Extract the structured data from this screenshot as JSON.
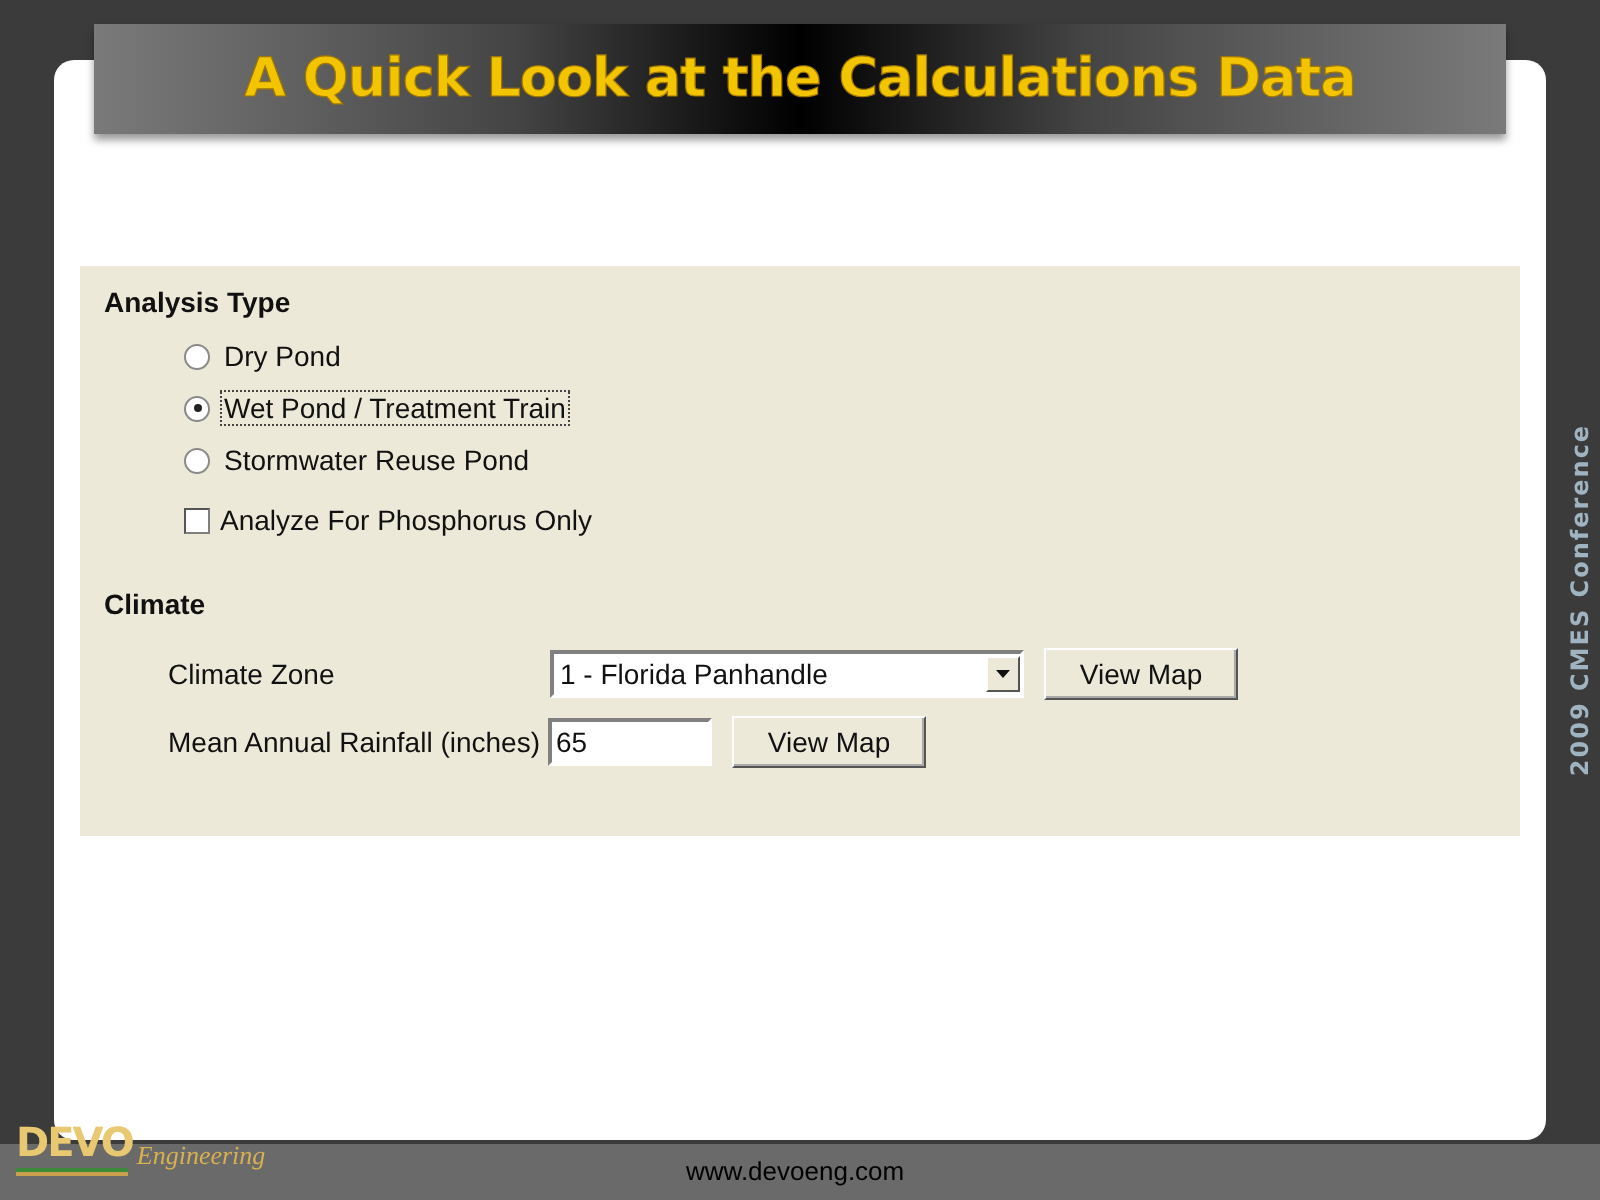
{
  "slide": {
    "title": "A Quick Look at the Calculations Data",
    "side_caption": "2009 CMES Conference",
    "footer_url": "www.devoeng.com",
    "logo": {
      "wordmark": "DEVO",
      "script": "Engineering"
    }
  },
  "analysis_type": {
    "heading": "Analysis Type",
    "options": [
      {
        "label": "Dry Pond",
        "selected": false
      },
      {
        "label": "Wet Pond / Treatment Train",
        "selected": true
      },
      {
        "label": "Stormwater Reuse Pond",
        "selected": false
      }
    ],
    "phosphorus_only": {
      "label": "Analyze For Phosphorus Only",
      "checked": false
    }
  },
  "climate": {
    "heading": "Climate",
    "zone": {
      "label": "Climate Zone",
      "value": "1 - Florida Panhandle",
      "button": "View Map"
    },
    "rainfall": {
      "label": "Mean Annual Rainfall (inches)",
      "value": "65",
      "button": "View Map"
    }
  }
}
